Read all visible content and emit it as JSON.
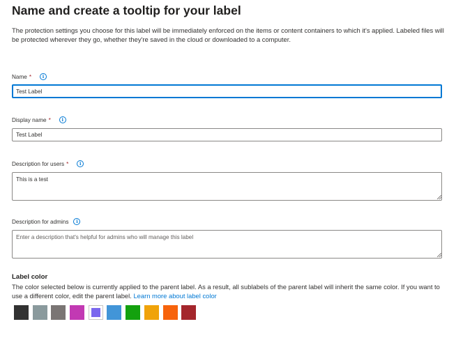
{
  "page": {
    "title": "Name and create a tooltip for your label",
    "intro": "The protection settings you choose for this label will be immediately enforced on the items or content containers to which it's applied. Labeled files will be protected wherever they go, whether they're saved in the cloud or downloaded to a computer."
  },
  "fields": {
    "name": {
      "label": "Name",
      "required": "*",
      "value": "Test Label"
    },
    "display_name": {
      "label": "Display name",
      "required": "*",
      "value": "Test Label"
    },
    "description_users": {
      "label": "Description for users",
      "required": "*",
      "value": "This is a test"
    },
    "description_admins": {
      "label": "Description for admins",
      "placeholder": "Enter a description that's helpful for admins who will manage this label",
      "value": ""
    }
  },
  "info_icon_glyph": "i",
  "label_color": {
    "title": "Label color",
    "description": "The color selected below is currently applied to the parent label. As a result, all sublabels of the parent label will inherit the same color. If you want to use a different color, edit the parent label.",
    "link_text": "Learn more about label color",
    "selected_index": 4,
    "swatches": [
      "#323232",
      "#8a9a9d",
      "#7a7574",
      "#c239b3",
      "#7b68ee",
      "#4295d8",
      "#13a10e",
      "#f0a30a",
      "#f7630c",
      "#a4262c"
    ]
  }
}
